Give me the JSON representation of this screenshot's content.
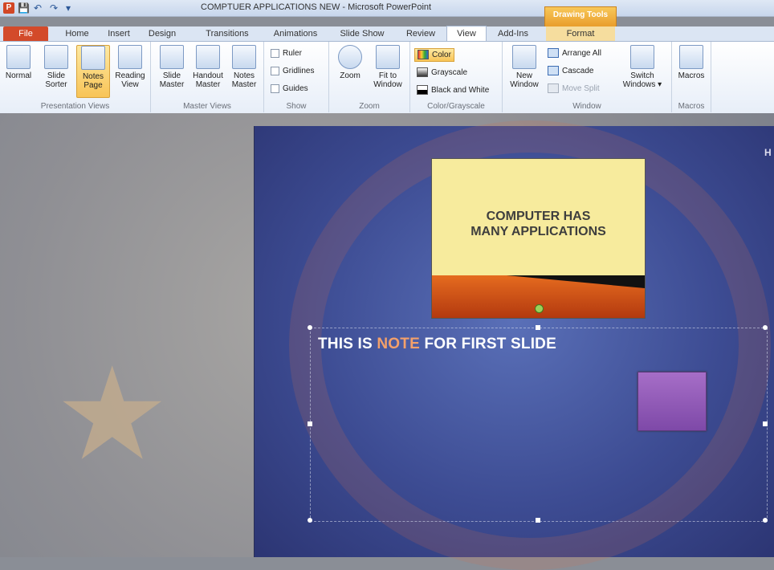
{
  "window": {
    "title": "COMPTUER APPLICATIONS NEW - Microsoft PowerPoint",
    "contextual_tab": "Drawing Tools"
  },
  "tabs": [
    "File",
    "Home",
    "Insert",
    "Design",
    "Transitions",
    "Animations",
    "Slide Show",
    "Review",
    "View",
    "Add-Ins",
    "Format"
  ],
  "active_tab": "View",
  "ribbon": {
    "presentation_views": {
      "label": "Presentation Views",
      "normal": "Normal",
      "slide_sorter_1": "Slide",
      "slide_sorter_2": "Sorter",
      "notes_page_1": "Notes",
      "notes_page_2": "Page",
      "reading_view_1": "Reading",
      "reading_view_2": "View"
    },
    "master_views": {
      "label": "Master Views",
      "slide_master_1": "Slide",
      "slide_master_2": "Master",
      "handout_master_1": "Handout",
      "handout_master_2": "Master",
      "notes_master_1": "Notes",
      "notes_master_2": "Master"
    },
    "show": {
      "label": "Show",
      "ruler": "Ruler",
      "gridlines": "Gridlines",
      "guides": "Guides"
    },
    "zoom": {
      "label": "Zoom",
      "zoom": "Zoom",
      "fit_1": "Fit to",
      "fit_2": "Window"
    },
    "color": {
      "label": "Color/Grayscale",
      "color": "Color",
      "grayscale": "Grayscale",
      "bw": "Black and White"
    },
    "window": {
      "label": "Window",
      "new_1": "New",
      "new_2": "Window",
      "arrange_all": "Arrange All",
      "cascade": "Cascade",
      "move_split": "Move Split",
      "switch_1": "Switch",
      "switch_2": "Windows"
    },
    "macros": {
      "label": "Macros",
      "macros": "Macros"
    }
  },
  "slide_thumbnail": {
    "title_line1": "COMPUTER HAS",
    "title_line2": "MANY APPLICATIONS"
  },
  "notes": {
    "part1": "THIS IS ",
    "highlight": "NOTE",
    "part2": " FOR FIRST SLIDE"
  },
  "edge_text": "H"
}
